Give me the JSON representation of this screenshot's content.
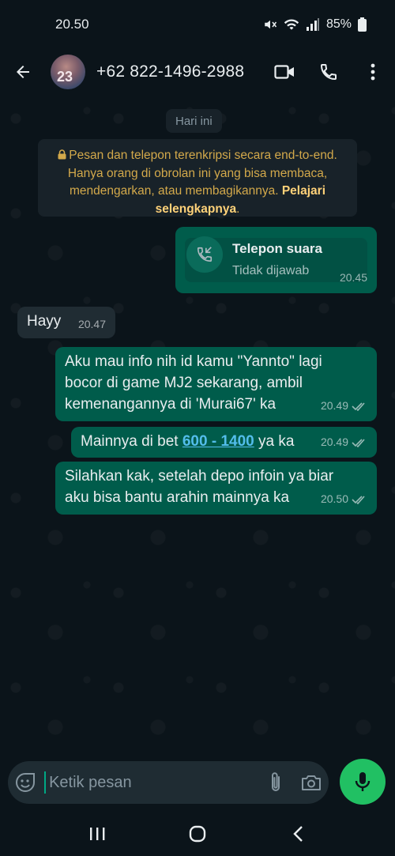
{
  "status": {
    "time": "20.50",
    "battery": "85%"
  },
  "header": {
    "avatar_text": "23",
    "contact": "+62 822-1496-2988"
  },
  "chat": {
    "date_chip": "Hari ini",
    "e2e_notice": "Pesan dan telepon terenkripsi secara end-to-end. Hanya orang di obrolan ini yang bisa membaca, mendengarkan, atau membagikannya.",
    "e2e_link": "Pelajari selengkapnya",
    "call": {
      "title": "Telepon suara",
      "subtitle": "Tidak dijawab",
      "time": "20.45"
    },
    "messages": [
      {
        "direction": "in",
        "text": "Hayy",
        "time": "20.47"
      },
      {
        "direction": "out",
        "text": "Aku mau info nih id kamu \"Yannto\" lagi bocor di game MJ2 sekarang, ambil kemenangannya di 'Murai67' ka",
        "time": "20.49"
      },
      {
        "direction": "out",
        "text_before": "Mainnya di bet ",
        "link": "600 - 1400",
        "text_after": " ya ka",
        "time": "20.49"
      },
      {
        "direction": "out",
        "text": "Silahkan kak, setelah depo infoin ya biar aku bisa bantu arahin mainnya ka",
        "time": "20.50"
      }
    ]
  },
  "input": {
    "placeholder": "Ketik pesan"
  },
  "colors": {
    "outgoing": "#005c4b",
    "incoming": "#202c33",
    "accent": "#21c063",
    "link": "#53bdeb"
  }
}
